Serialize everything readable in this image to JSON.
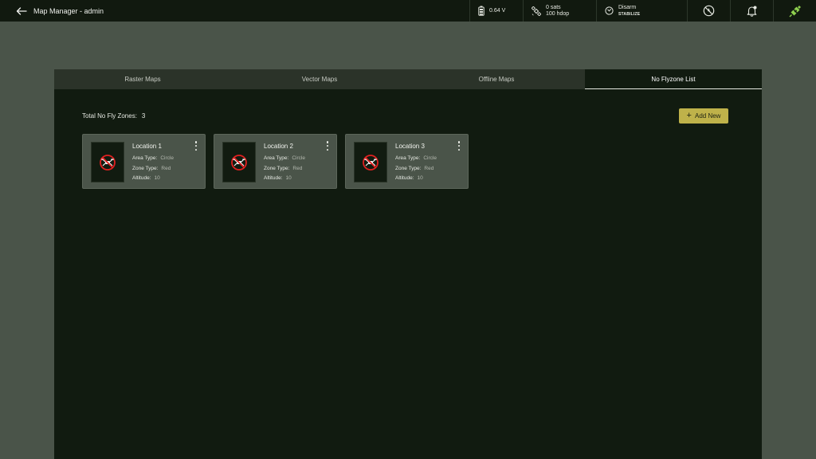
{
  "header": {
    "title": "Map Manager - admin",
    "back_icon": "arrow-left-icon"
  },
  "status": {
    "battery": "0.64 V",
    "gps_sats": "0 sats",
    "gps_hdop": "100 hdop",
    "arm_state": "Disarm",
    "flight_mode": "STABILIZE"
  },
  "tabs": [
    {
      "label": "Raster Maps",
      "active": false
    },
    {
      "label": "Vector Maps",
      "active": false
    },
    {
      "label": "Offline Maps",
      "active": false
    },
    {
      "label": "No Flyzone List",
      "active": true
    }
  ],
  "summary": {
    "total_label": "Total No Fly Zones:",
    "total_count": "3",
    "add_label": "Add New"
  },
  "zone_labels": {
    "area_type": "Area Type:",
    "zone_type": "Zone Type:",
    "altitude": "Altitude:"
  },
  "zones": [
    {
      "name": "Location 1",
      "area_type": "Circle",
      "zone_type": "Red",
      "altitude": "10"
    },
    {
      "name": "Location 2",
      "area_type": "Circle",
      "zone_type": "Red",
      "altitude": "10"
    },
    {
      "name": "Location 3",
      "area_type": "Circle",
      "zone_type": "Red",
      "altitude": "10"
    }
  ],
  "colors": {
    "accent": "#bfb24a",
    "connected": "#8fd14f",
    "no_fly_red": "#e02020"
  }
}
